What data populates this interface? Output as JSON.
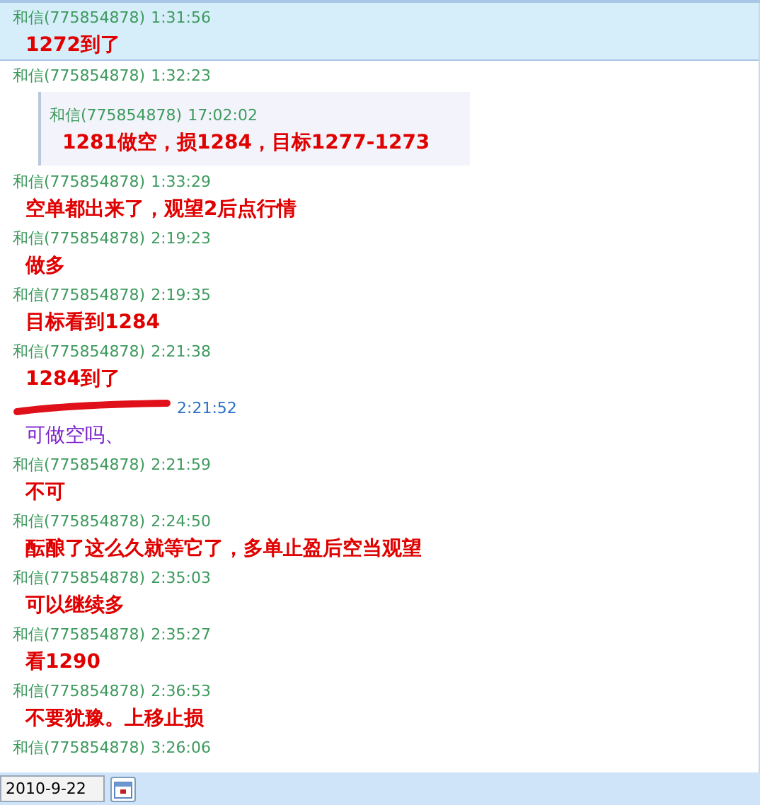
{
  "messages": [
    {
      "sender": "和信(775854878)",
      "time": "1:31:56",
      "text": "1272到了",
      "color": "#e00000",
      "selected": true
    },
    {
      "sender": "和信(775854878)",
      "time": "1:32:23",
      "quote": {
        "sender": "和信(775854878)",
        "time": "17:02:02",
        "text": "1281做空，损1284，目标1277-1273"
      },
      "selected": false
    },
    {
      "sender": "和信(775854878)",
      "time": "1:33:29",
      "text": "空单都出来了，观望2后点行情",
      "color": "#e00000",
      "selected": false
    },
    {
      "sender": "和信(775854878)",
      "time": "2:19:23",
      "text": "做多",
      "color": "#e00000",
      "selected": false
    },
    {
      "sender": "和信(775854878)",
      "time": "2:19:35",
      "text": "目标看到1284",
      "color": "#e00000",
      "selected": false
    },
    {
      "sender": "和信(775854878)",
      "time": "2:21:38",
      "text": "1284到了",
      "color": "#e00000",
      "selected": false
    },
    {
      "redacted": true,
      "time": "2:21:52",
      "text": "可做空吗、",
      "color": "#7a22cc",
      "selected": false
    },
    {
      "sender": "和信(775854878)",
      "time": "2:21:59",
      "text": "不可",
      "color": "#e00000",
      "selected": false
    },
    {
      "sender": "和信(775854878)",
      "time": "2:24:50",
      "text": "酝酿了这么久就等它了，多单止盈后空当观望",
      "color": "#e00000",
      "selected": false
    },
    {
      "sender": "和信(775854878)",
      "time": "2:35:03",
      "text": "可以继续多",
      "color": "#e00000",
      "selected": false
    },
    {
      "sender": "和信(775854878)",
      "time": "2:35:27",
      "text": "看1290",
      "color": "#e00000",
      "selected": false
    },
    {
      "sender": "和信(775854878)",
      "time": "2:36:53",
      "text": "不要犹豫。上移止损",
      "color": "#e00000",
      "selected": false
    },
    {
      "sender": "和信(775854878)",
      "time": "3:26:06",
      "selected": false
    }
  ],
  "date_field": {
    "value": "2010-9-22"
  }
}
